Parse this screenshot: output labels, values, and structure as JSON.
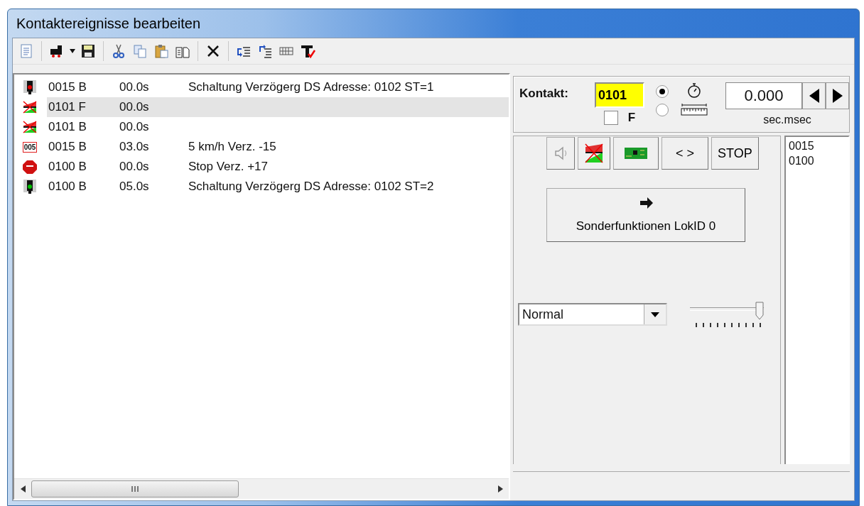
{
  "window": {
    "title": "Kontaktereignisse bearbeiten"
  },
  "toolbar": [
    {
      "kind": "doc"
    },
    {
      "kind": "sep"
    },
    {
      "kind": "loco"
    },
    {
      "kind": "dropdown"
    },
    {
      "kind": "save"
    },
    {
      "kind": "sep"
    },
    {
      "kind": "cut"
    },
    {
      "kind": "copy"
    },
    {
      "kind": "paste"
    },
    {
      "kind": "copy2"
    },
    {
      "kind": "sep"
    },
    {
      "kind": "delete"
    },
    {
      "kind": "sep"
    },
    {
      "kind": "indent-down"
    },
    {
      "kind": "indent-up"
    },
    {
      "kind": "grid"
    },
    {
      "kind": "text-check"
    }
  ],
  "events": [
    {
      "kind": "signal-red",
      "address": "0015 B",
      "time": "00.0s",
      "description": "Schaltung Verzögerg DS Adresse: 0102 ST=1",
      "selected": false
    },
    {
      "kind": "contact",
      "address": "0101 F",
      "time": "00.0s",
      "selected": true
    },
    {
      "kind": "contact",
      "address": "0101 B",
      "time": "00.0s",
      "selected": false
    },
    {
      "kind": "speed",
      "badge": "005",
      "address": "0015 B",
      "time": "03.0s",
      "description": "5 km/h Verz. -15",
      "selected": false
    },
    {
      "kind": "stop",
      "address": "0100 B",
      "time": "00.0s",
      "description": "Stop Verz. +17",
      "selected": false
    },
    {
      "kind": "signal-green",
      "address": "0100 B",
      "time": "05.0s",
      "description": "Schaltung Verzögerg DS Adresse: 0102 ST=2",
      "selected": false
    }
  ],
  "contact": {
    "label": "Kontakt:",
    "value": "0101",
    "f_checked": false,
    "f_label": "F",
    "mode_time_selected": true,
    "mode_distance_selected": false,
    "duration": "0.000",
    "unit": "sec.msec"
  },
  "action_buttons": [
    {
      "kind": "sound"
    },
    {
      "kind": "contact"
    },
    {
      "kind": "board"
    },
    {
      "kind": "text",
      "label": "< >"
    },
    {
      "kind": "text",
      "label": "STOP"
    }
  ],
  "function_button": {
    "label": "Sonderfunktionen LokID 0"
  },
  "mode_select": {
    "value": "Normal"
  },
  "slider": {
    "level": 1
  },
  "addresses": [
    "0015",
    "0100"
  ]
}
